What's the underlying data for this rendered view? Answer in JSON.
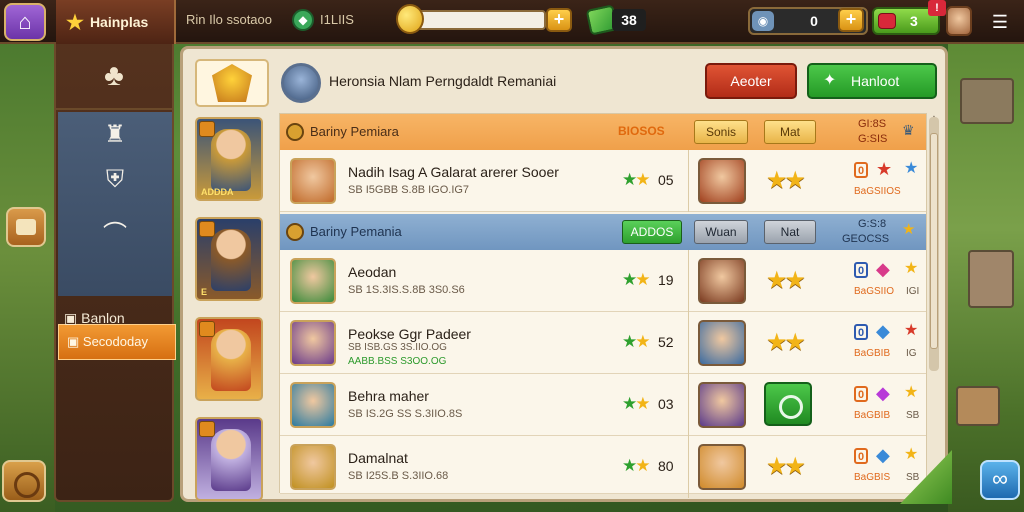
{
  "topbar": {
    "home_icon": "home-icon",
    "title": "Hainplas",
    "res1": "Rin Ilo ssotaoo",
    "res2": "I1LIIS",
    "coin_plus": "+",
    "cash_value": "38",
    "energy_value": "0",
    "energy_plus": "+",
    "gem_value": "3",
    "alert": "!",
    "menu_icon": "menu-icon"
  },
  "leftnav": {
    "active_label": "Secododay",
    "item2_label": "Banlon"
  },
  "panel": {
    "header_title": "Heronsia Nlam Perngdaldt Remaniai",
    "btn_red": "Aeoter",
    "btn_green": "Hanloot"
  },
  "heroes": [
    {
      "label": "ADDDA",
      "colors": [
        "#3b5478",
        "#c99a3a"
      ]
    },
    {
      "label": "E",
      "colors": [
        "#2a3f6a",
        "#8a5a2a"
      ]
    },
    {
      "label": "",
      "colors": [
        "#c2461e",
        "#e8b048"
      ]
    },
    {
      "label": "",
      "colors": [
        "#5a3a8a",
        "#c0b0e0"
      ]
    }
  ],
  "groups": [
    {
      "name": "Bariny Pemiara",
      "value": "BIOSOS",
      "chip1": "Sonis",
      "chip2": "Mat",
      "num_top": "GI:8S",
      "num_bot": "G:SIS"
    },
    {
      "name": "Bariny Pemania",
      "chip1": "ADDOS",
      "chip2": "Wuan",
      "chip3": "Nat",
      "num_top": "G:S:8",
      "num_bot": "GEOCSS"
    }
  ],
  "rows": [
    {
      "name": "Nadih Isag A Galarat arerer Sooer",
      "sub": "SB I5GBB S.8B IGO.IG7",
      "rating": "05",
      "meta_num": "0",
      "code": "BaGSIIOS",
      "code2": ""
    },
    {
      "name": "Aeodan",
      "sub": "SB 1S.3IS.S.8B 3S0.S6",
      "rating": "19",
      "meta_num": "0",
      "code": "BaGSIIO",
      "code2": "IGI"
    },
    {
      "name": "Peokse Ggr Padeer",
      "sub": "SB ISB.GS 3S.IIO.OG",
      "rating": "52",
      "meta_num": "0",
      "code": "BaGBIB",
      "code2": "IG",
      "extra": "AABB.BSS S3OO.OG"
    },
    {
      "name": "Behra maher",
      "sub": "SB IS.2G SS S.3IIO.8S",
      "rating": "03",
      "meta_num": "0",
      "code": "BaGBIB",
      "code2": "SB"
    },
    {
      "name": "Damalnat",
      "sub": "SB I25S.B S.3IIO.68",
      "rating": "80",
      "meta_num": "0",
      "code": "BaGBIS",
      "code2": "SB"
    }
  ],
  "colors": {
    "accent_orange": "#f29a34",
    "accent_green": "#2ea02e",
    "accent_red": "#b22c18",
    "star_gold": "#f2b417"
  }
}
